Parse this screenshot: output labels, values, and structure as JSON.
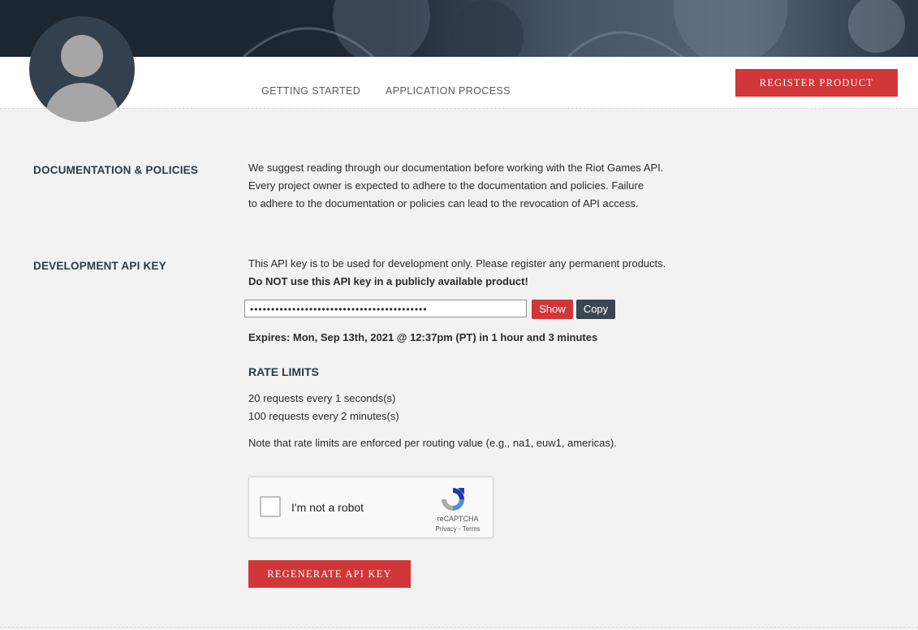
{
  "nav": {
    "getting_started": "GETTING STARTED",
    "application_process": "APPLICATION PROCESS",
    "register_product": "REGISTER PRODUCT"
  },
  "docs": {
    "title": "DOCUMENTATION & POLICIES",
    "lines": [
      "We suggest reading through our documentation before working with the Riot Games API.",
      "Every project owner is expected to adhere to the documentation and policies. Failure",
      "to adhere to the documentation or policies can lead to the revocation of API access."
    ]
  },
  "api_key": {
    "title": "DEVELOPMENT API KEY",
    "intro": "This API key is to be used for development only. Please register any permanent products.",
    "warning": "Do NOT use this API key in a publicly available product!",
    "masked_value": "••••••••••••••••••••••••••••••••••••••••••",
    "show_label": "Show",
    "copy_label": "Copy",
    "expires": "Expires: Mon, Sep 13th, 2021 @ 12:37pm (PT) in 1 hour and 3 minutes"
  },
  "rate_limits": {
    "title": "RATE LIMITS",
    "limits": [
      "20 requests every 1 seconds(s)",
      "100 requests every 2 minutes(s)"
    ],
    "note": "Note that rate limits are enforced per routing value (e.g., na1, euw1, americas)."
  },
  "recaptcha": {
    "label": "I'm not a robot",
    "brand": "reCAPTCHA",
    "links": "Privacy - Terms"
  },
  "regenerate_label": "REGENERATE API KEY",
  "colors": {
    "accent_red": "#d13639",
    "dark_slate": "#3b4654",
    "banner": "#1c2631",
    "background": "#f2f2f2"
  }
}
